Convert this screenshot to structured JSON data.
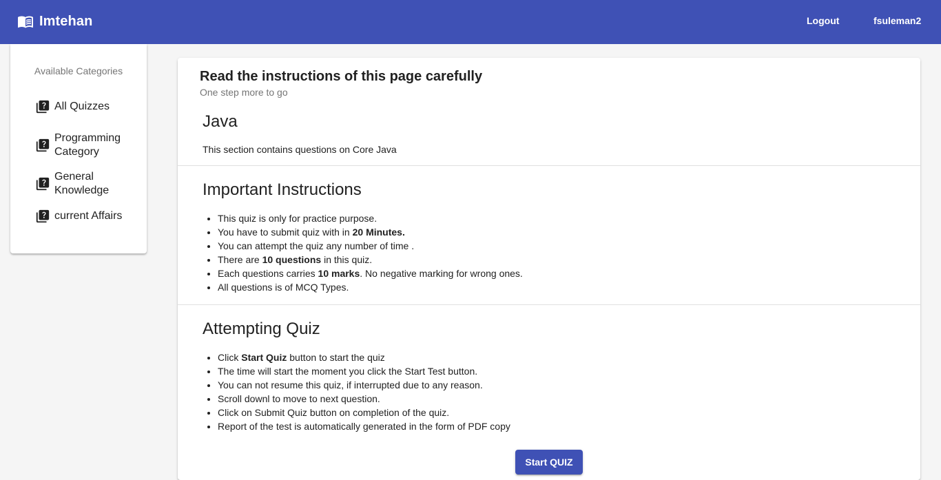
{
  "app": {
    "title": "Imtehan",
    "logo_icon": "book-open-icon",
    "accent": "#3f51b5"
  },
  "header": {
    "logout_label": "Logout",
    "username": "fsuleman2"
  },
  "sidebar": {
    "heading": "Available Categories",
    "items": [
      {
        "label": "All Quizzes",
        "icon": "quiz-icon"
      },
      {
        "label": "Programming Category",
        "icon": "quiz-icon"
      },
      {
        "label": "General Knowledge",
        "icon": "quiz-icon"
      },
      {
        "label": "current Affairs",
        "icon": "quiz-icon"
      }
    ]
  },
  "main": {
    "title": "Read the instructions of this page carefully",
    "subtitle": "One step more to go",
    "quiz_title": "Java",
    "quiz_description": "This section contains questions on Core Java",
    "important": {
      "heading": "Important Instructions",
      "items": [
        {
          "pre": "This quiz is only for practice purpose.",
          "bold": "",
          "post": ""
        },
        {
          "pre": "You have to submit quiz with in ",
          "bold": "20 Minutes.",
          "post": ""
        },
        {
          "pre": "You can attempt the quiz any number of time .",
          "bold": "",
          "post": ""
        },
        {
          "pre": "There are ",
          "bold": "10 questions",
          "post": " in this quiz."
        },
        {
          "pre": "Each questions carries ",
          "bold": "10 marks",
          "post": ". No negative marking for wrong ones."
        },
        {
          "pre": "All questions is of MCQ Types.",
          "bold": "",
          "post": ""
        }
      ]
    },
    "attempting": {
      "heading": "Attempting Quiz",
      "items": [
        {
          "pre": "Click ",
          "bold": "Start Quiz",
          "post": " button to start the quiz"
        },
        {
          "pre": "The time will start the moment you click the Start Test button.",
          "bold": "",
          "post": ""
        },
        {
          "pre": "You can not resume this quiz, if interrupted due to any reason.",
          "bold": "",
          "post": ""
        },
        {
          "pre": "Scroll downl to move to next question.",
          "bold": "",
          "post": ""
        },
        {
          "pre": "Click on Submit Quiz button on completion of the quiz.",
          "bold": "",
          "post": ""
        },
        {
          "pre": "Report of the test is automatically generated in the form of PDF copy",
          "bold": "",
          "post": ""
        }
      ]
    },
    "start_button": "Start QUIZ"
  }
}
